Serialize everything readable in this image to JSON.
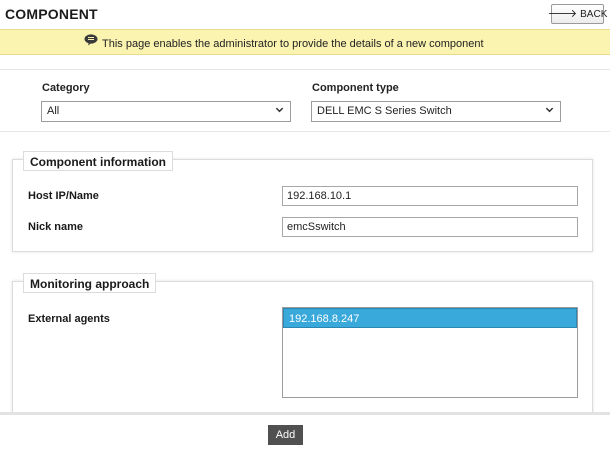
{
  "header": {
    "title": "COMPONENT",
    "back_label": "BACK"
  },
  "banner": {
    "text": "This page enables the administrator to provide the details of a new component"
  },
  "selectors": {
    "category_label": "Category",
    "category_value": "All",
    "component_type_label": "Component type",
    "component_type_value": "DELL EMC S Series Switch"
  },
  "component_information": {
    "legend": "Component information",
    "host_label": "Host IP/Name",
    "host_value": "192.168.10.1",
    "nick_label": "Nick name",
    "nick_value": "emcSswitch"
  },
  "monitoring": {
    "legend": "Monitoring approach",
    "external_agents_label": "External agents",
    "external_agents_options": [
      "192.168.8.247"
    ],
    "selected_option_index": 0
  },
  "actions": {
    "add_label": "Add"
  },
  "colors": {
    "banner_bg": "#fbf4b0",
    "selected_option_bg": "#39a9dc",
    "add_button_bg": "#505050"
  },
  "icons": {
    "back": "back-arrow-icon",
    "banner": "speech-bubble-icon",
    "dropdown": "chevron-down-icon"
  }
}
